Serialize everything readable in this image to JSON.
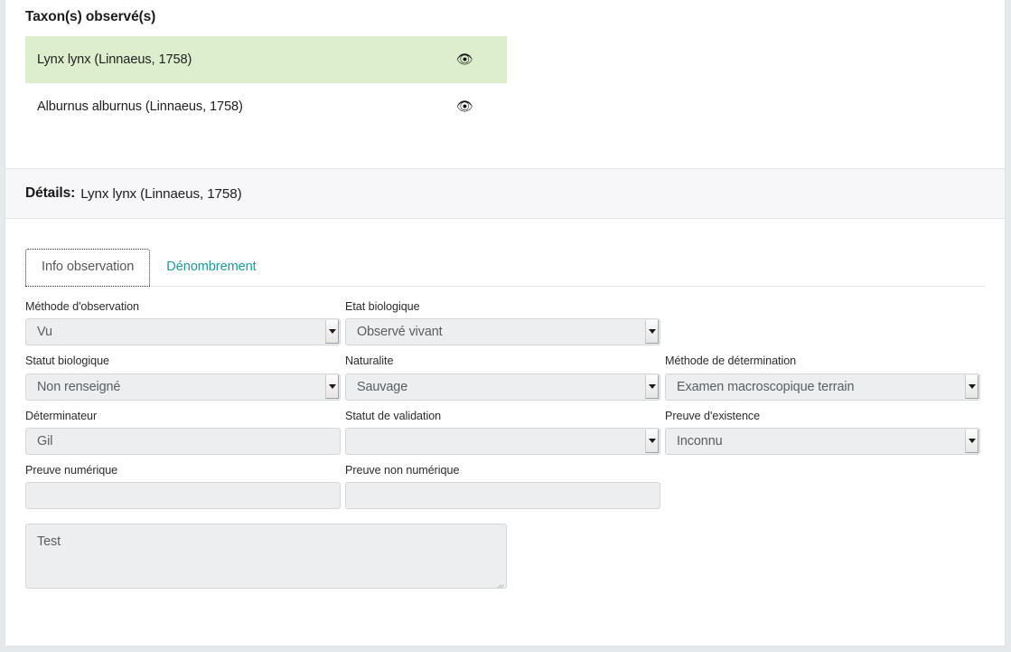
{
  "taxon_section": {
    "title": "Taxon(s) observé(s)",
    "eye_icon": "eye-icon",
    "items": [
      {
        "label": "Lynx lynx (Linnaeus, 1758)",
        "selected": true
      },
      {
        "label": "Alburnus alburnus (Linnaeus, 1758)",
        "selected": false
      }
    ]
  },
  "details": {
    "label": "Détails:",
    "taxon": "Lynx lynx (Linnaeus, 1758)"
  },
  "tabs": [
    {
      "label": "Info observation",
      "active": true
    },
    {
      "label": "Dénombrement",
      "active": false
    }
  ],
  "form": {
    "rows": [
      [
        {
          "label": "Méthode d'observation",
          "value": "Vu",
          "type": "select",
          "name": "methode-observation"
        },
        {
          "label": "Etat biologique",
          "value": "Observé vivant",
          "type": "select",
          "name": "etat-biologique"
        }
      ],
      [
        {
          "label": "Statut biologique",
          "value": "Non renseigné",
          "type": "select",
          "name": "statut-biologique"
        },
        {
          "label": "Naturalite",
          "value": "Sauvage",
          "type": "select",
          "name": "naturalite"
        },
        {
          "label": "Méthode de détermination",
          "value": "Examen macroscopique terrain",
          "type": "select",
          "name": "methode-determination"
        }
      ],
      [
        {
          "label": "Déterminateur",
          "value": "Gil",
          "type": "text",
          "name": "determinateur"
        },
        {
          "label": "Statut de validation",
          "value": "",
          "type": "select",
          "name": "statut-validation"
        },
        {
          "label": "Preuve d'existence",
          "value": "Inconnu",
          "type": "select",
          "name": "preuve-existence"
        }
      ],
      [
        {
          "label": "Preuve numérique",
          "value": "",
          "type": "text",
          "name": "preuve-numerique"
        },
        {
          "label": "Preuve non numérique",
          "value": "",
          "type": "text",
          "name": "preuve-non-numerique"
        }
      ]
    ],
    "comment": {
      "value": "Test",
      "name": "comment-textarea"
    }
  },
  "colors": {
    "selected_row": "#ddeecd",
    "tab_link": "#1f9b9b",
    "field_bg": "#eceeef",
    "header_bg": "#f7f7f9",
    "page_bg": "#e4e9ec"
  }
}
